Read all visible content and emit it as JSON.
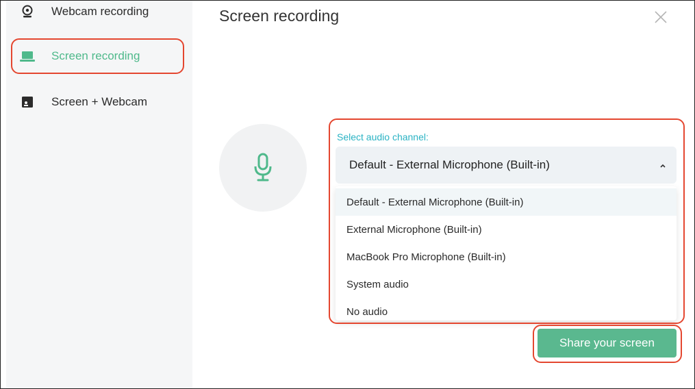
{
  "sidebar": {
    "items": [
      {
        "label": "Webcam recording",
        "icon": "webcam-icon"
      },
      {
        "label": "Screen recording",
        "icon": "laptop-icon"
      },
      {
        "label": "Screen + Webcam",
        "icon": "screen-webcam-icon"
      }
    ],
    "active_index": 1
  },
  "main": {
    "title": "Screen recording",
    "audio_label": "Select audio channel:",
    "selected_option": "Default - External Microphone (Built-in)",
    "options": [
      "Default - External Microphone (Built-in)",
      "External Microphone (Built-in)",
      "MacBook Pro Microphone (Built-in)",
      "System audio",
      "No audio"
    ],
    "share_button": "Share your screen"
  },
  "colors": {
    "accent": "#4fb98b",
    "button": "#5ab88f",
    "label": "#2ab3c4",
    "highlight_ring": "#e4462f"
  }
}
